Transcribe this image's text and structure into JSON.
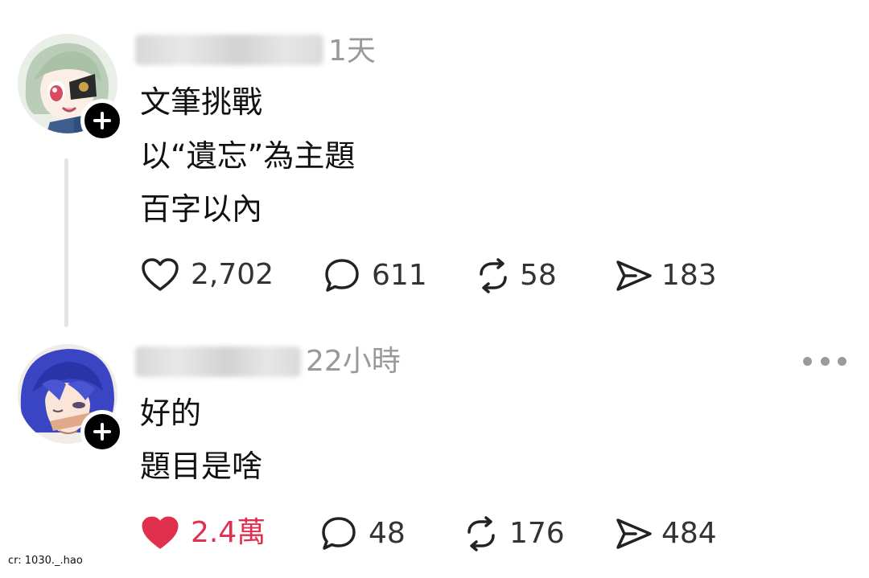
{
  "posts": [
    {
      "timestamp": "1天",
      "lines": [
        "文筆挑戰",
        "以“遺忘”為主題",
        "百字以內"
      ],
      "actions": {
        "likes": "2,702",
        "comments": "611",
        "reposts": "58",
        "shares": "183"
      },
      "liked": false
    },
    {
      "timestamp": "22小時",
      "lines": [
        "好的",
        "題目是啥"
      ],
      "actions": {
        "likes": "2.4萬",
        "comments": "48",
        "reposts": "176",
        "shares": "484"
      },
      "liked": true
    }
  ],
  "icons": {
    "like": "heart-icon",
    "comment": "speech-bubble-icon",
    "repost": "repost-arrows-icon",
    "share": "paper-plane-icon",
    "more": "ellipsis-icon",
    "follow": "plus-icon"
  },
  "colors": {
    "liked": "#e0304e",
    "muted": "#999999",
    "text": "#111111"
  },
  "credit": "cr: 1030._.hao"
}
